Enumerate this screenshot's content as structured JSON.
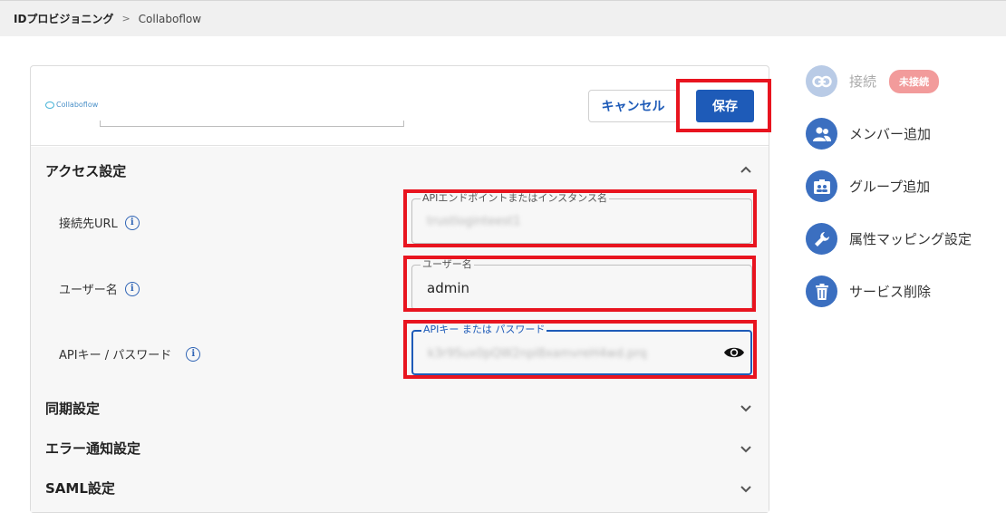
{
  "breadcrumb": {
    "root": "IDプロビジョニング",
    "separator": ">",
    "current": "Collaboflow"
  },
  "header": {
    "logo_text": "Collaboflow",
    "cancel_label": "キャンセル",
    "save_label": "保存"
  },
  "access_section": {
    "title": "アクセス設定",
    "expanded": true,
    "fields": [
      {
        "label": "接続先URL",
        "floating_label": "APIエンドポイントまたはインスタンス名",
        "value": "trustloginteest1",
        "masked": true
      },
      {
        "label": "ユーザー名",
        "floating_label": "ユーザー名",
        "value": "admin",
        "masked": false
      },
      {
        "label": "APIキー / パスワード",
        "floating_label": "APIキー または パスワード",
        "value": "k3r9Sux0pQW2npl8xamvreH4wd.prq",
        "masked": true,
        "focused": true
      }
    ]
  },
  "collapsed_sections": [
    {
      "title": "同期設定"
    },
    {
      "title": "エラー通知設定"
    },
    {
      "title": "SAML設定"
    }
  ],
  "sidebar": {
    "items": [
      {
        "label": "接続",
        "icon": "link-icon",
        "badge": "未接続",
        "disabled": true
      },
      {
        "label": "メンバー追加",
        "icon": "people-icon"
      },
      {
        "label": "グループ追加",
        "icon": "group-card-icon"
      },
      {
        "label": "属性マッピング設定",
        "icon": "wrench-icon"
      },
      {
        "label": "サービス削除",
        "icon": "trash-icon"
      }
    ]
  },
  "colors": {
    "primary": "#1e5bb8",
    "highlight": "#e8141f",
    "badge": "#f29b9b",
    "sidebar_icon": "#3b6fc0"
  }
}
